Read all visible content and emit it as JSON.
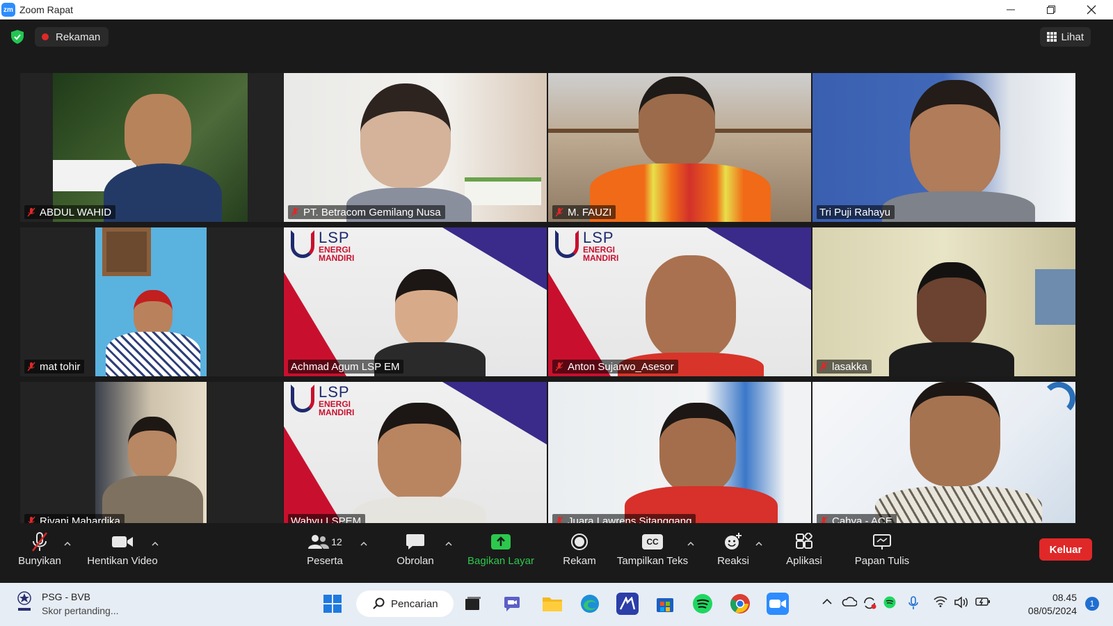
{
  "window": {
    "app_logo": "zm",
    "title": "Zoom Rapat"
  },
  "topbar": {
    "recording_label": "Rekaman",
    "view_label": "Lihat"
  },
  "participants": [
    {
      "name": "ABDUL WAHID",
      "muted": true
    },
    {
      "name": "PT. Betracom Gemilang Nusa",
      "muted": true
    },
    {
      "name": "M. FAUZI",
      "muted": true
    },
    {
      "name": "Tri Puji Rahayu",
      "muted": false
    },
    {
      "name": "mat tohir",
      "muted": true
    },
    {
      "name": "Achmad Agum LSP EM",
      "muted": false,
      "active_speaker": true
    },
    {
      "name": "Anton Sujarwo_Asesor",
      "muted": true
    },
    {
      "name": "lasakka",
      "muted": true
    },
    {
      "name": "Rivani Mahardika",
      "muted": true
    },
    {
      "name": "Wahyu  LSPEM",
      "muted": false
    },
    {
      "name": "Juara Lawrens Sitanggang",
      "muted": true
    },
    {
      "name": "Cahya - ACE",
      "muted": true
    }
  ],
  "lsp_banner": {
    "line1": "LSP",
    "line2": "ENERGI",
    "line3": "MANDIRI"
  },
  "toolbar": {
    "unmute_label": "Bunyikan",
    "stop_video_label": "Hentikan Video",
    "participants_label": "Peserta",
    "participants_count": "12",
    "chat_label": "Obrolan",
    "share_label": "Bagikan Layar",
    "record_label": "Rekam",
    "captions_label": "Tampilkan Teks",
    "captions_icon_text": "CC",
    "reactions_label": "Reaksi",
    "apps_label": "Aplikasi",
    "whiteboard_label": "Papan Tulis",
    "leave_label": "Keluar"
  },
  "taskbar": {
    "news_title": "PSG - BVB",
    "news_sub": "Skor pertanding...",
    "search_label": "Pencarian",
    "time": "08.45",
    "date": "08/05/2024",
    "notification_count": "1"
  },
  "colors": {
    "share_green": "#2cc84d",
    "leave_red": "#e02828",
    "active_border": "#dde05a"
  }
}
